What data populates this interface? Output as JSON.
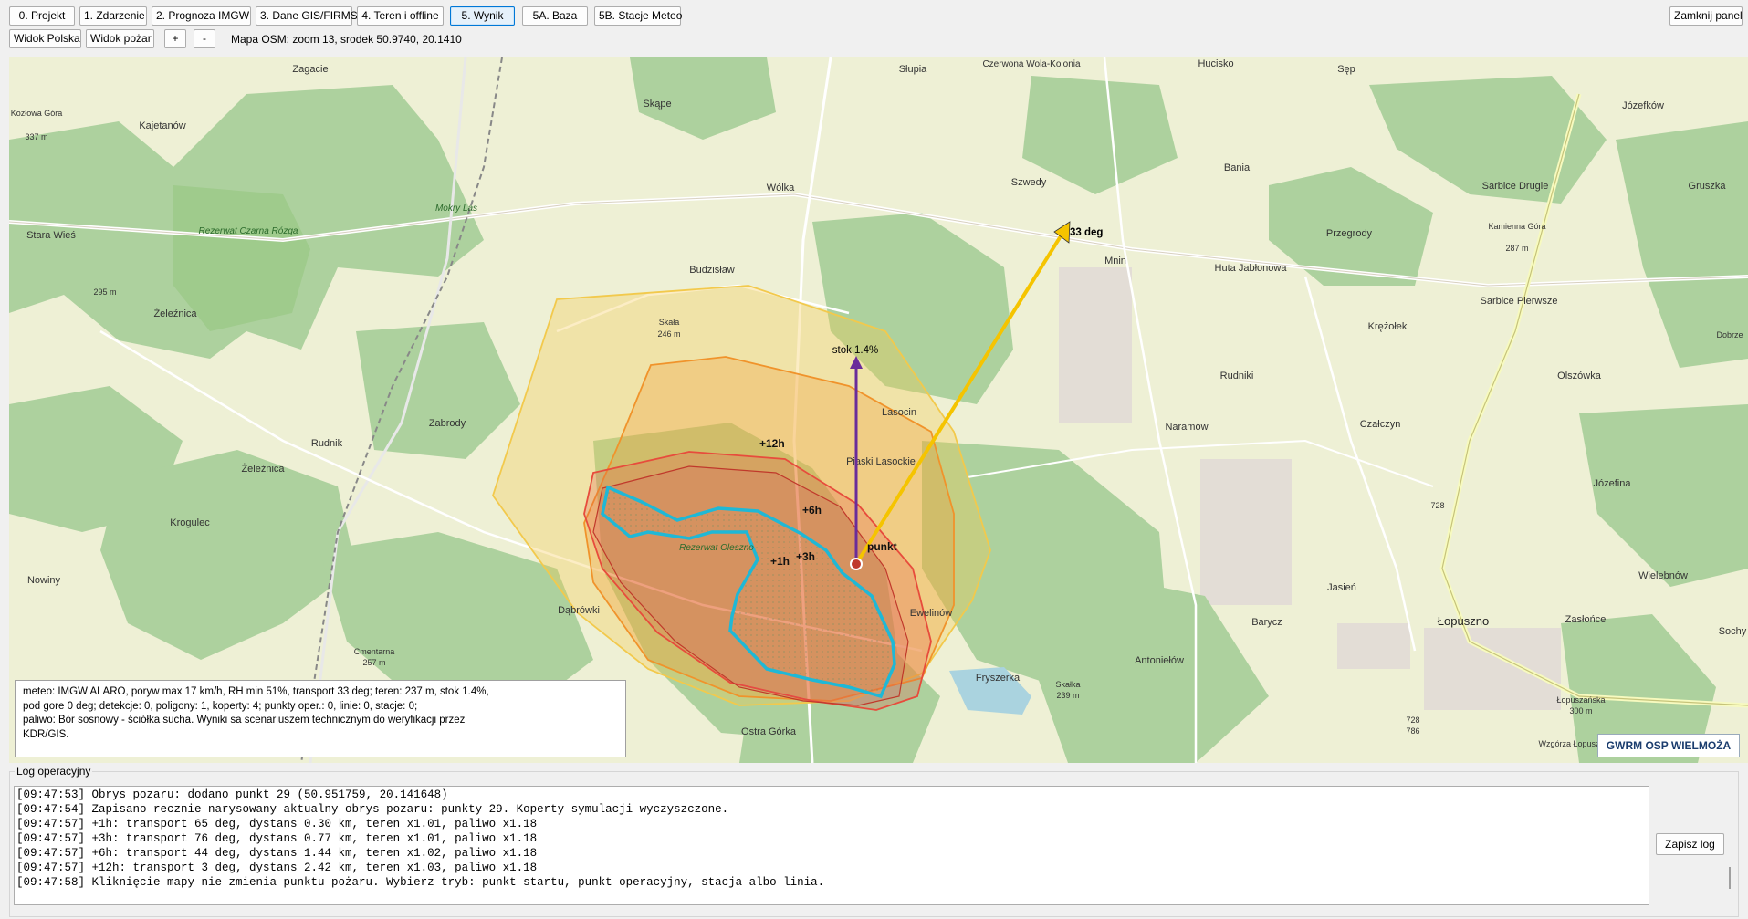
{
  "toolbar": {
    "tabs": [
      {
        "label": "0. Projekt"
      },
      {
        "label": "1. Zdarzenie"
      },
      {
        "label": "2. Prognoza IMGW"
      },
      {
        "label": "3. Dane GIS/FIRMS"
      },
      {
        "label": "4. Teren i offline"
      },
      {
        "label": "5. Wynik",
        "active": true
      },
      {
        "label": "5A. Baza"
      },
      {
        "label": "5B. Stacje Meteo"
      }
    ],
    "close_panel": "Zamknij panel",
    "view_poland": "Widok Polska",
    "view_fire": "Widok pożar",
    "zoom_in": "+",
    "zoom_out": "-",
    "map_status": "Mapa OSM: zoom 13, srodek 50.9740, 20.1410"
  },
  "map": {
    "places": [
      "Zagacie",
      "Kozłowa Góra",
      "337 m",
      "Kajetanów",
      "Stara Wieś",
      "Rezerwat Czarna Rózga",
      "295 m",
      "Mokry Las",
      "Skąpe",
      "Słupia",
      "Czerwona Wola-Kolonia",
      "Hucisko",
      "Sęp",
      "Józefków",
      "Wólka",
      "Szwedy",
      "Bania",
      "Sarbice Drugie",
      "Gruszka",
      "Przegrody",
      "Mnin",
      "Kamienna Góra",
      "287 m",
      "Budzisław",
      "Huta Jabłonowa",
      "Sarbice Pierwsze",
      "Dobrze",
      "Żeleźnica",
      "Skała",
      "246 m",
      "Krężołek",
      "Rudniki",
      "Olszówka",
      "Zabrody",
      "Lasocin",
      "Naramów",
      "Rudnik",
      "Czałczyn",
      "Piaski Lasockie",
      "Żeleźnica",
      "Józefina",
      "Krogulec",
      "728",
      "Nowiny",
      "Rezerwat Oleszno",
      "Dąbrówki",
      "Jasień",
      "Wielebnów",
      "Barycz",
      "Łopuszno",
      "Zasłońce",
      "Ewelinów",
      "Cmentarna",
      "257 m",
      "Fryszerka",
      "Skałka",
      "239 m",
      "Antoniełów",
      "Ostra Górka",
      "Łopuszańska",
      "300 m",
      "728",
      "786",
      "Wzgórza Łopuszańskie",
      "Sochy"
    ],
    "wind_label": "33 deg",
    "slope_label": "stok 1.4%",
    "time_labels": [
      "+12h",
      "+6h",
      "+3h",
      "+1h"
    ],
    "point_label": "punkt"
  },
  "info": {
    "line1": "meteo: IMGW ALARO, poryw max 17 km/h, RH min 51%, transport 33 deg; teren: 237 m, stok 1.4%,",
    "line2": "pod gore 0 deg; detekcje: 0, poligony: 1, koperty: 4; punkty oper.: 0, linie: 0, stacje: 0;",
    "line3": "paliwo: Bór sosnowy - ściółka sucha. Wyniki sa scenariuszem technicznym do weryfikacji przez",
    "line4": "KDR/GIS."
  },
  "org_badge": "GWRM OSP WIELMOŻA",
  "log": {
    "title": "Log operacyjny",
    "lines": [
      "[09:47:53] Obrys pozaru: dodano punkt 29 (50.951759, 20.141648)",
      "[09:47:54] Zapisano recznie narysowany aktualny obrys pozaru: punkty 29. Koperty symulacji wyczyszczone.",
      "[09:47:57] +1h: transport 65 deg, dystans 0.30 km, teren x1.01, paliwo x1.18",
      "[09:47:57] +3h: transport 76 deg, dystans 0.77 km, teren x1.01, paliwo x1.18",
      "[09:47:57] +6h: transport 44 deg, dystans 1.44 km, teren x1.02, paliwo x1.18",
      "[09:47:57] +12h: transport 3 deg, dystans 2.42 km, teren x1.03, paliwo x1.18",
      "[09:47:58] Kliknięcie mapy nie zmienia punktu pożaru. Wybierz tryb: punkt startu, punkt operacyjny, stacja albo linia."
    ],
    "save_button": "Zapisz log"
  },
  "colors": {
    "forest": "#add19e",
    "farmland": "#eef0d5",
    "envelope_12h": "#f2c94c",
    "envelope_6h": "#f0932b",
    "envelope_3h": "#e74c3c",
    "perimeter": "#1fb8d6",
    "wind_arrow": "#f5c400",
    "slope_arrow": "#6a2c9a"
  }
}
